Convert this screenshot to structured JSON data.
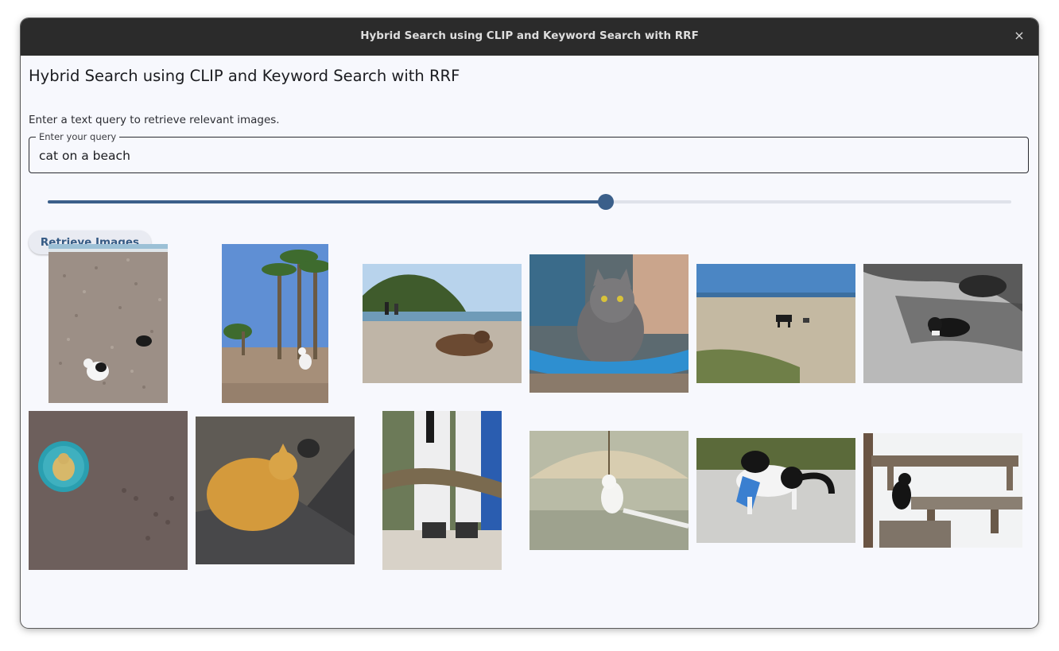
{
  "window": {
    "title": "Hybrid Search using CLIP and Keyword Search with RRF",
    "close_glyph": "×"
  },
  "page": {
    "heading": "Hybrid Search using CLIP and Keyword Search with RRF",
    "description": "Enter a text query to retrieve relevant images."
  },
  "query": {
    "label": "Enter your query",
    "value": "cat on a beach"
  },
  "slider": {
    "fraction": 0.579
  },
  "button": {
    "label": "Retrieve Images"
  },
  "results": [
    "cat-on-pebble-beach-image",
    "cat-under-palm-trees-image",
    "cow-lying-on-beach-image",
    "gray-cat-in-blue-tube-image",
    "dogs-on-beach-image",
    "black-cat-under-car-image",
    "cat-badge-on-sand-image",
    "orange-cat-on-lap-image",
    "cat-tail-with-surfboards-image",
    "white-cat-under-umbrella-image",
    "black-white-cat-with-bag-image",
    "black-cat-on-snowy-bench-image"
  ],
  "colors": {
    "accent": "#3b5f8a",
    "titlebar": "#2b2b2b",
    "background": "#f7f8fd"
  }
}
